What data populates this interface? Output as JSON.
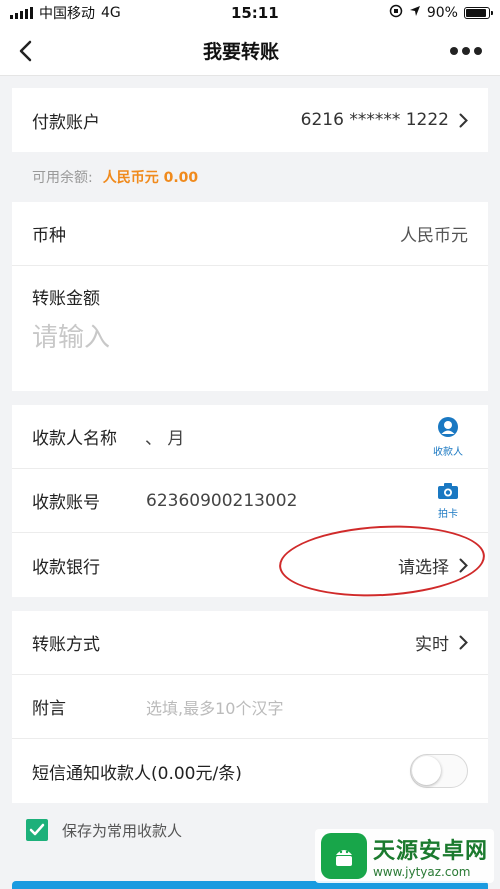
{
  "status_bar": {
    "carrier": "中国移动",
    "network": "4G",
    "time": "15:11",
    "battery": "90%",
    "battery_level": 0.9
  },
  "nav": {
    "title": "我要转账",
    "back_icon": "chevron-left-icon",
    "more_icon": "more-dots-icon"
  },
  "payer": {
    "label": "付款账户",
    "account": "6216 ****** 1222"
  },
  "balance": {
    "label": "可用余额:",
    "amount": "人民币元 0.00"
  },
  "currency": {
    "label": "币种",
    "value": "人民币元"
  },
  "amount": {
    "label": "转账金额",
    "placeholder": "请输入"
  },
  "payee": {
    "name_label": "收款人名称",
    "name_value": "、  月",
    "contacts_button": "收款人",
    "account_label": "收款账号",
    "account_value": "62360900213002",
    "scan_button": "拍卡",
    "bank_label": "收款银行",
    "bank_value": "请选择"
  },
  "options": {
    "method_label": "转账方式",
    "method_value": "实时",
    "memo_label": "附言",
    "memo_placeholder": "选填,最多10个汉字",
    "sms_label": "短信通知收款人(0.00元/条)",
    "sms_enabled": false
  },
  "save_payee": {
    "label": "保存为常用收款人",
    "checked": true
  },
  "watermark": {
    "name": "天源安卓网",
    "url": "www.jytyaz.com"
  },
  "colors": {
    "accent": "#1a78c2",
    "balance": "#f08a1c",
    "check": "#1db07a",
    "annotation": "#d02a2a"
  }
}
